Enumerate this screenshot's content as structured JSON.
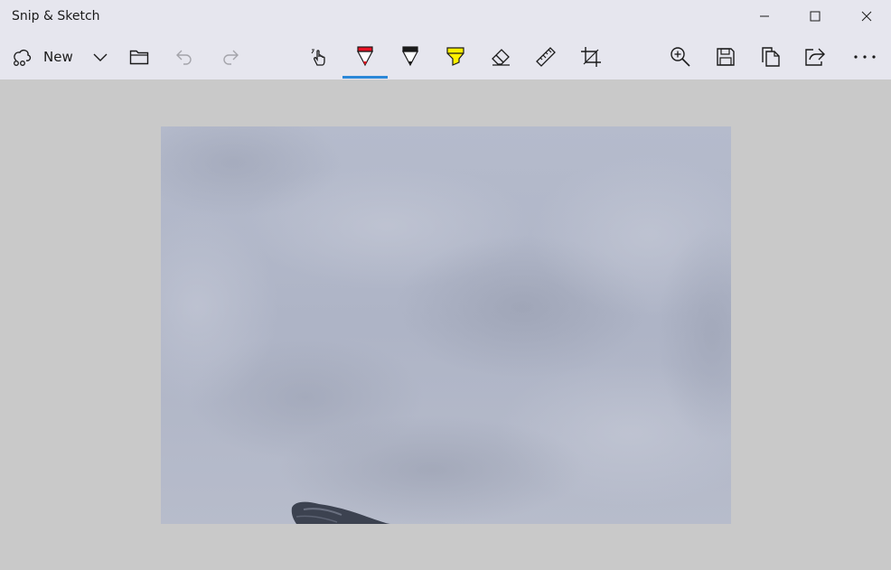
{
  "app": {
    "title": "Snip & Sketch"
  },
  "titlebar": {
    "buttons": [
      "minimize-icon",
      "maximize-icon",
      "close-icon"
    ]
  },
  "toolbar": {
    "new_label": "New",
    "tools": [
      {
        "name": "touch-writing-icon"
      },
      {
        "name": "ballpoint-pen-icon",
        "selected": true,
        "color": "#e81123"
      },
      {
        "name": "pencil-icon",
        "color": "#1a1a1a"
      },
      {
        "name": "highlighter-icon",
        "color": "#fff100"
      },
      {
        "name": "eraser-icon"
      },
      {
        "name": "ruler-icon"
      },
      {
        "name": "crop-icon"
      }
    ],
    "active_accent": "#2b88d8"
  },
  "colors": {
    "chrome": "#e6e6ee",
    "canvas": "#c9c9c9"
  }
}
